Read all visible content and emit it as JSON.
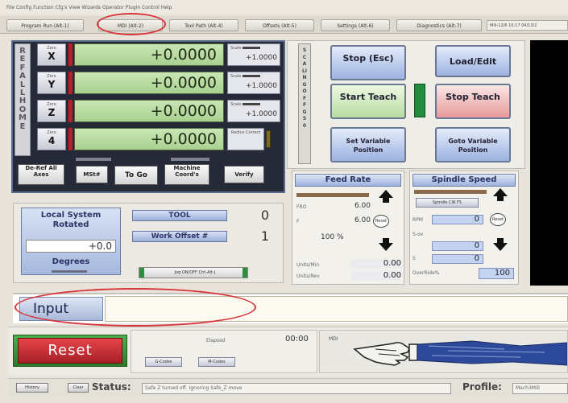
{
  "menubar": {
    "text": "File  Config  Function Cfg's  View  Wizards  Operator  PlugIn Control  Help"
  },
  "tabs": [
    {
      "label": "Program Run (Alt-1)"
    },
    {
      "label": "MDI (Alt-2)"
    },
    {
      "label": "Tool Path (Alt-4)"
    },
    {
      "label": "Offsets (Alt-5)"
    },
    {
      "label": "Settings (Alt-6)"
    },
    {
      "label": "Diagnostics (Alt-7)"
    }
  ],
  "datetime": "Mill-12/6 10:17 04/13/2",
  "ref_all_home": "REF ALL HOME",
  "axes": [
    {
      "zero_label": "Zero",
      "axis": "X",
      "dro": "+0.0000",
      "scale_label": "Scale",
      "scale": "+1.0000"
    },
    {
      "zero_label": "Zero",
      "axis": "Y",
      "dro": "+0.0000",
      "scale_label": "Scale",
      "scale": "+1.0000"
    },
    {
      "zero_label": "Zero",
      "axis": "Z",
      "dro": "+0.0000",
      "scale_label": "Scale",
      "scale": "+1.0000"
    },
    {
      "zero_label": "Zero",
      "axis": "4",
      "dro": "+0.0000",
      "scale_label": "Radius Correct",
      "scale": ""
    }
  ],
  "axis_buttons": {
    "de_ref": "De-Ref All Axes",
    "mstr": "MSt#",
    "to_go": "To Go",
    "machine_coords": "Machine Coord's",
    "verify": "Verify"
  },
  "soft_limits": "SCALING OFF G50",
  "buttons": {
    "stop": "Stop (Esc)",
    "load_edit": "Load/Edit",
    "start_teach": "Start Teach",
    "stop_teach": "Stop Teach",
    "set_variable": "Set Variable Position",
    "goto_variable": "Goto Variable Position"
  },
  "feed": {
    "title": "Feed Rate",
    "fro_label": "FRO",
    "fro_value": "6.00",
    "f_label": "F",
    "f_value": "6.00",
    "percent": "100 %",
    "reset": "Reset",
    "units_min_label": "Units/Min",
    "units_min": "0.00",
    "units_rev_label": "Units/Rev",
    "units_rev": "0.00"
  },
  "spindle": {
    "title": "Spindle Speed",
    "cw_label": "Spindle CW F5",
    "rpm_label": "RPM",
    "rpm": "0",
    "sov_label": "S-ov",
    "sov": "0",
    "s_label": "S",
    "s": "0",
    "override_label": "OverRide%",
    "override": "100",
    "reset": "Reset"
  },
  "local_system": {
    "title": "Local System Rotated",
    "value": "+0.0",
    "degrees": "Degrees",
    "tool_label": "TOOL",
    "tool_value": "0",
    "work_offset_label": "Work Offset #",
    "work_offset_value": "1",
    "jog_label": "Jog ON/OFF Ctrl-Alt-J"
  },
  "input": {
    "label": "Input",
    "value": ""
  },
  "reset_label": "Reset",
  "elapsed_label": "Elapsed",
  "elapsed_value": "00:00",
  "gcodes": "G-Codes",
  "mcodes": "M-Codes",
  "mdi_label": "MDI",
  "status": {
    "history": "History",
    "clear": "Clear",
    "label": "Status:",
    "text": "Safe Z turned off. Ignoring Safe_Z move",
    "profile_label": "Profile:",
    "profile": "Mach3Mill"
  },
  "colors": {
    "dro_green": "#a9d190",
    "reset_red": "#c8282f",
    "highlight": "#d9343a",
    "panel_blue": "#9fb2de"
  }
}
